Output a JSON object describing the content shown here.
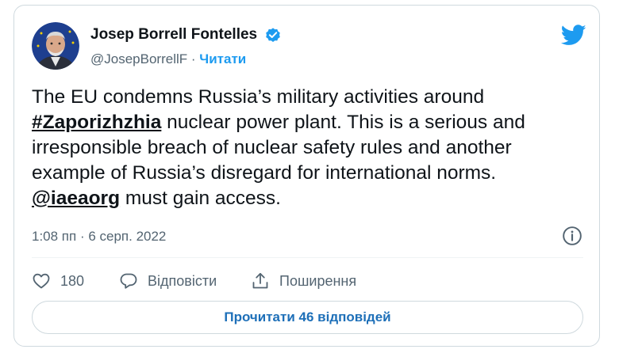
{
  "author": {
    "name": "Josep Borrell Fontelles",
    "handle": "@JosepBorrellF",
    "separator": "·",
    "follow_label": "Читати"
  },
  "tweet": {
    "text_1": "The EU condemns Russia’s military activities around ",
    "hashtag": "#Zaporizhzhia",
    "text_2": " nuclear power plant. This is a serious and irresponsible breach of nuclear safety rules and another example of Russia’s disregard for international norms. ",
    "mention": "@iaeaorg",
    "text_3": " must gain access.",
    "timestamp": "1:08 пп · 6 серп. 2022"
  },
  "actions": {
    "likes_count": "180",
    "reply_label": "Відповісти",
    "share_label": "Поширення"
  },
  "read_replies_label": "Прочитати 46 відповідей",
  "colors": {
    "accent": "#1d9bf0",
    "text": "#0f1419",
    "muted": "#536471",
    "border": "#cfd9de"
  },
  "icons": [
    "avatar",
    "verified-badge-icon",
    "twitter-logo-icon",
    "info-icon",
    "heart-icon",
    "reply-icon",
    "share-icon"
  ]
}
